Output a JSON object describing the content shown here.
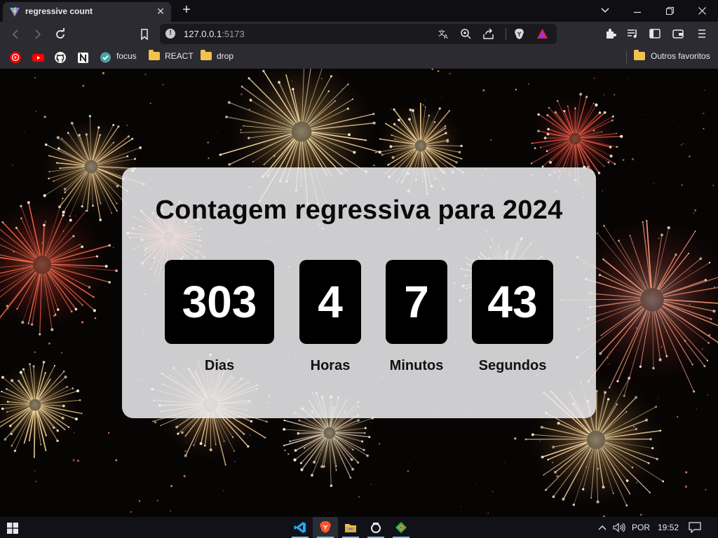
{
  "browser": {
    "tab": {
      "title": "regressive count"
    },
    "address": {
      "host": "127.0.0.1",
      "port": ":5173"
    },
    "bookmarks": [
      {
        "label": "focus"
      },
      {
        "label": "REACT"
      },
      {
        "label": "drop"
      }
    ],
    "other_bookmarks": "Outros favoritos"
  },
  "page": {
    "title": "Contagem regressiva para 2024",
    "units": [
      {
        "value": "303",
        "label": "Dias"
      },
      {
        "value": "4",
        "label": "Horas"
      },
      {
        "value": "7",
        "label": "Minutos"
      },
      {
        "value": "43",
        "label": "Segundos"
      }
    ]
  },
  "taskbar": {
    "language": "POR",
    "time": "19:52"
  },
  "colors": {
    "card_bg": "#eeeef0",
    "digit_box": "#000000",
    "accent_brave": "#fb542b"
  }
}
